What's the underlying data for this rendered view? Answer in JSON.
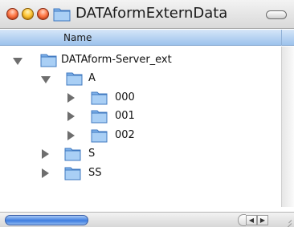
{
  "window": {
    "title": "DATAformExternData",
    "title_icon": "folder-icon"
  },
  "columns": {
    "name_header": "Name"
  },
  "tree": [
    {
      "label": "DATAform-Server_ext",
      "expanded": true,
      "level": 0
    },
    {
      "label": "A",
      "expanded": true,
      "level": 1
    },
    {
      "label": "000",
      "expanded": false,
      "level": 2
    },
    {
      "label": "001",
      "expanded": false,
      "level": 2
    },
    {
      "label": "002",
      "expanded": false,
      "level": 2
    },
    {
      "label": "S",
      "expanded": false,
      "level": 1
    },
    {
      "label": "SS",
      "expanded": false,
      "level": 1
    }
  ],
  "colors": {
    "header_blue": "#9cc2ec",
    "folder_blue": "#7fb2ea",
    "scroll_thumb": "#3d7de0"
  }
}
